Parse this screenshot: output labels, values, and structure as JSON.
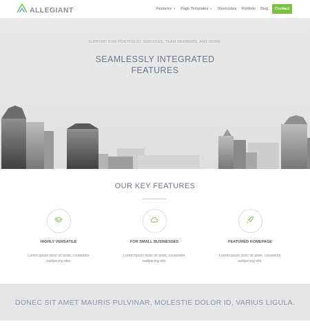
{
  "header": {
    "logo_text": "ALLEGIANT",
    "nav": [
      {
        "label": "Features",
        "has_dropdown": true
      },
      {
        "label": "Page Templates",
        "has_dropdown": true
      },
      {
        "label": "Shortcodes",
        "has_dropdown": false
      },
      {
        "label": "Portfolio",
        "has_dropdown": false
      },
      {
        "label": "Blog",
        "has_dropdown": false
      }
    ],
    "contact_label": "Contact"
  },
  "hero": {
    "subtitle": "SUPPORT FOR PORTFOLIO, SERVICES, TEAM MEMBERS, AND MORE.",
    "title_line1": "SEAMLESSLY INTEGRATED",
    "title_line2": "FEATURES"
  },
  "features": {
    "title": "OUR KEY FEATURES",
    "items": [
      {
        "icon": "layers-icon",
        "title": "HIGHLY VERSATILE",
        "text": "Lorem ipsum dolor sit amet, consetetur sadipscing elitr."
      },
      {
        "icon": "cloud-icon",
        "title": "FOR SMALL BUSINESSES",
        "text": "Lorem ipsum dolor sit amet, consetetur sadipscing elitr."
      },
      {
        "icon": "rocket-icon",
        "title": "FEATURED HOMEPAGE",
        "text": "Lorem ipsum dolor sit amet, consetetur sadipscing elitr."
      }
    ]
  },
  "band": {
    "text": "DONEC SIT AMET MAURIS PULVINAR, MOLESTIE DOLOR ID, VARIUS LIGULA."
  },
  "colors": {
    "accent": "#7ac142",
    "heading": "#6d7787",
    "band_bg": "#e6e6e6"
  }
}
